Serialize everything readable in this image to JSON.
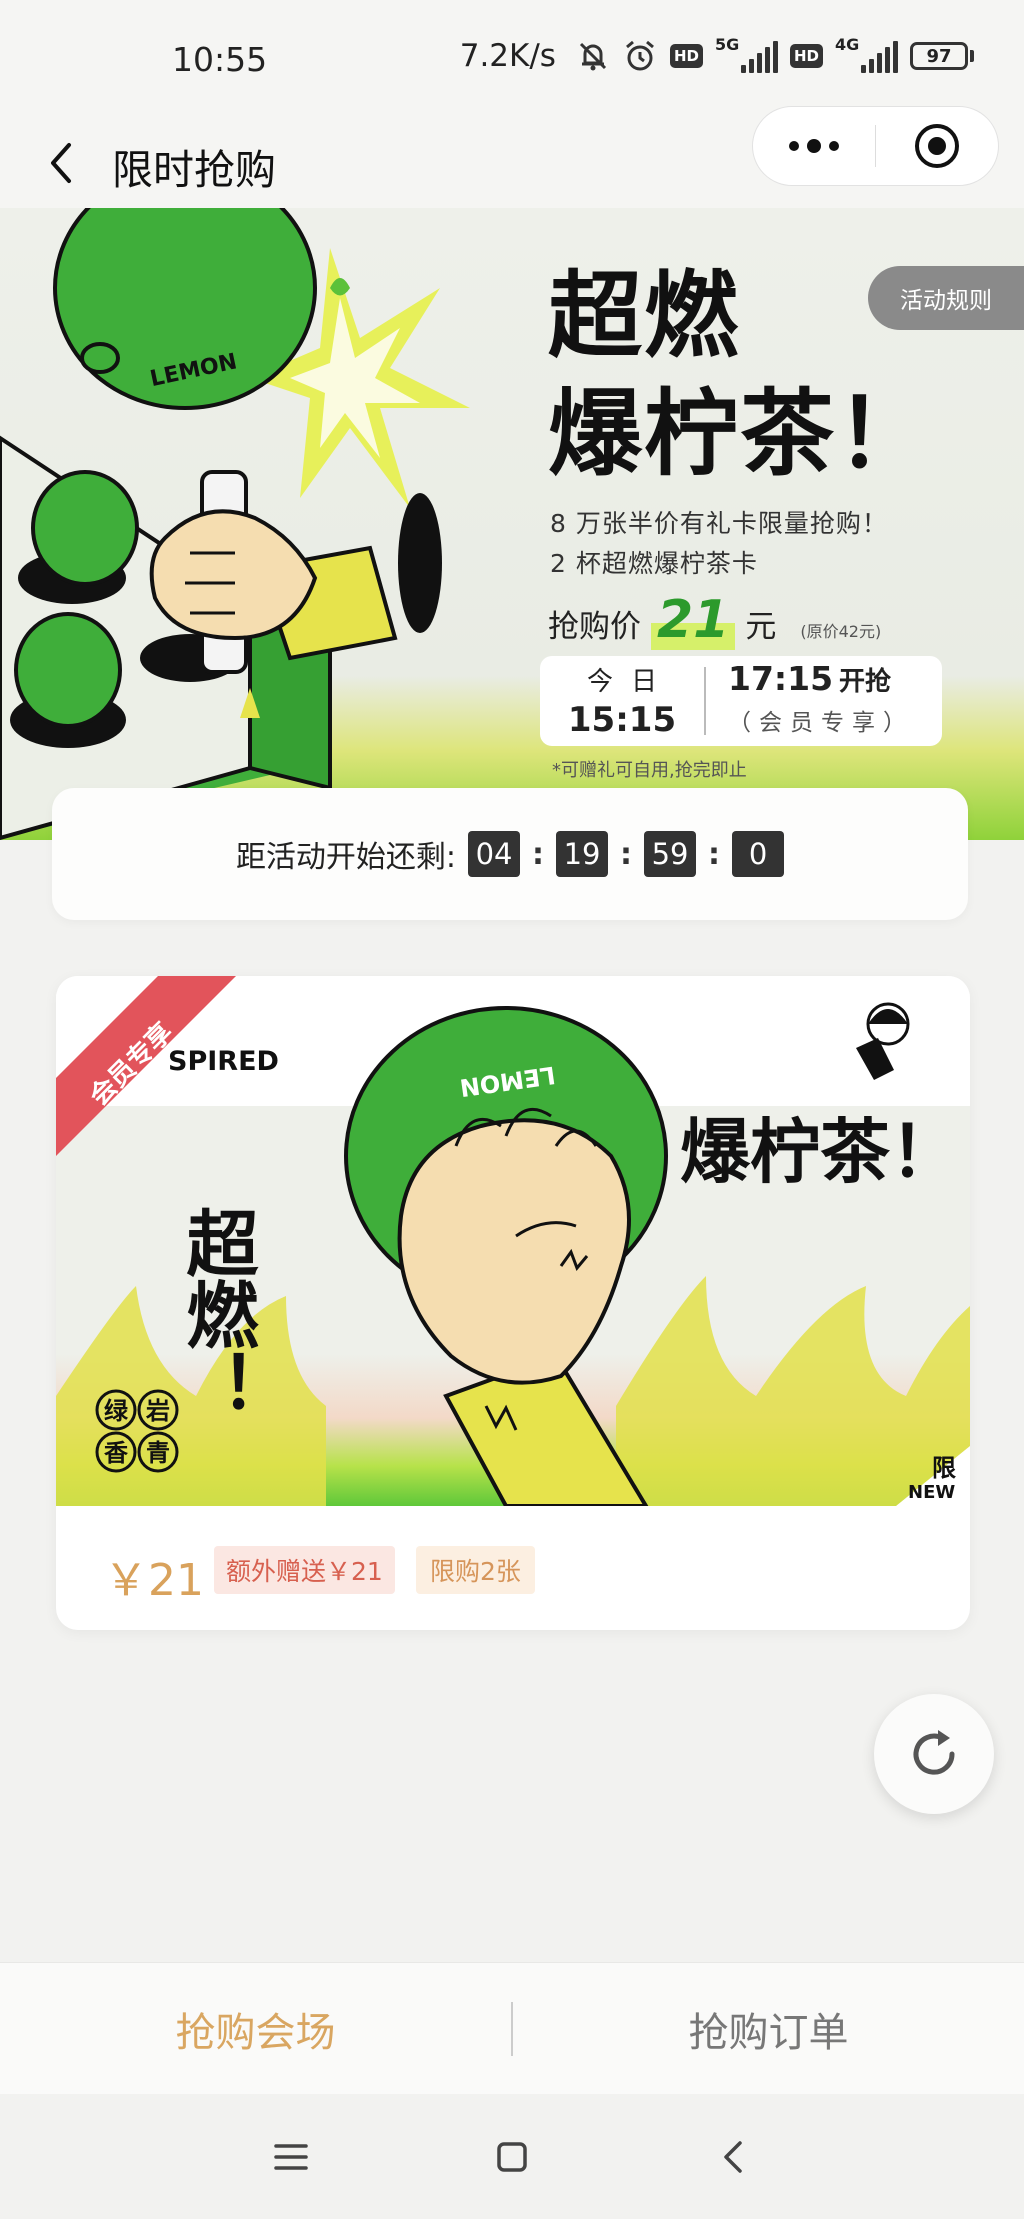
{
  "status_bar": {
    "time": "10:55",
    "net_speed": "7.2K/s",
    "hd_badge": "HD",
    "sim1_label": "5G",
    "sim2_label": "4G",
    "battery": "97"
  },
  "nav": {
    "title": "限时抢购"
  },
  "banner": {
    "rules_label": "活动规则",
    "headline_line1": "超燃",
    "headline_line2": "爆柠茶！",
    "sub1": "8 万张半价有礼卡限量抢购！",
    "sub2": "2 杯超燃爆柠茶卡",
    "price_label": "抢购价",
    "price_value": "21",
    "price_unit": "元",
    "price_original": "(原价42元)",
    "today_label": "今日",
    "today_time": "15:15",
    "open_time": "17:15",
    "open_label": "开抢",
    "member_label": "（会员专享）",
    "note": "*可赠礼可自用,抢完即止",
    "art_lemon_text": "LEMON"
  },
  "countdown": {
    "label": "距活动开始还剩:",
    "hours": "04",
    "minutes": "19",
    "seconds": "59",
    "tenths": "0"
  },
  "product": {
    "ribbon": "会员专享",
    "brand_partial": "SPIRED",
    "art_left": "超燃！",
    "art_right": "爆柠茶！",
    "art_lemon_text": "LEMON",
    "art_seal": [
      "绿",
      "岩",
      "香",
      "青"
    ],
    "art_corner_top": "限",
    "art_corner_bottom": "NEW",
    "price": "￥21",
    "gift_tag": "额外赠送￥21",
    "limit_tag": "限购2张"
  },
  "tabs": [
    {
      "label": "抢购会场",
      "active": true
    },
    {
      "label": "抢购订单",
      "active": false
    }
  ],
  "colors": {
    "accent_gold": "#d9a661",
    "lemon_green": "#3fae3a",
    "ribbon_red": "#e2545b",
    "countdown_box": "#333333"
  }
}
